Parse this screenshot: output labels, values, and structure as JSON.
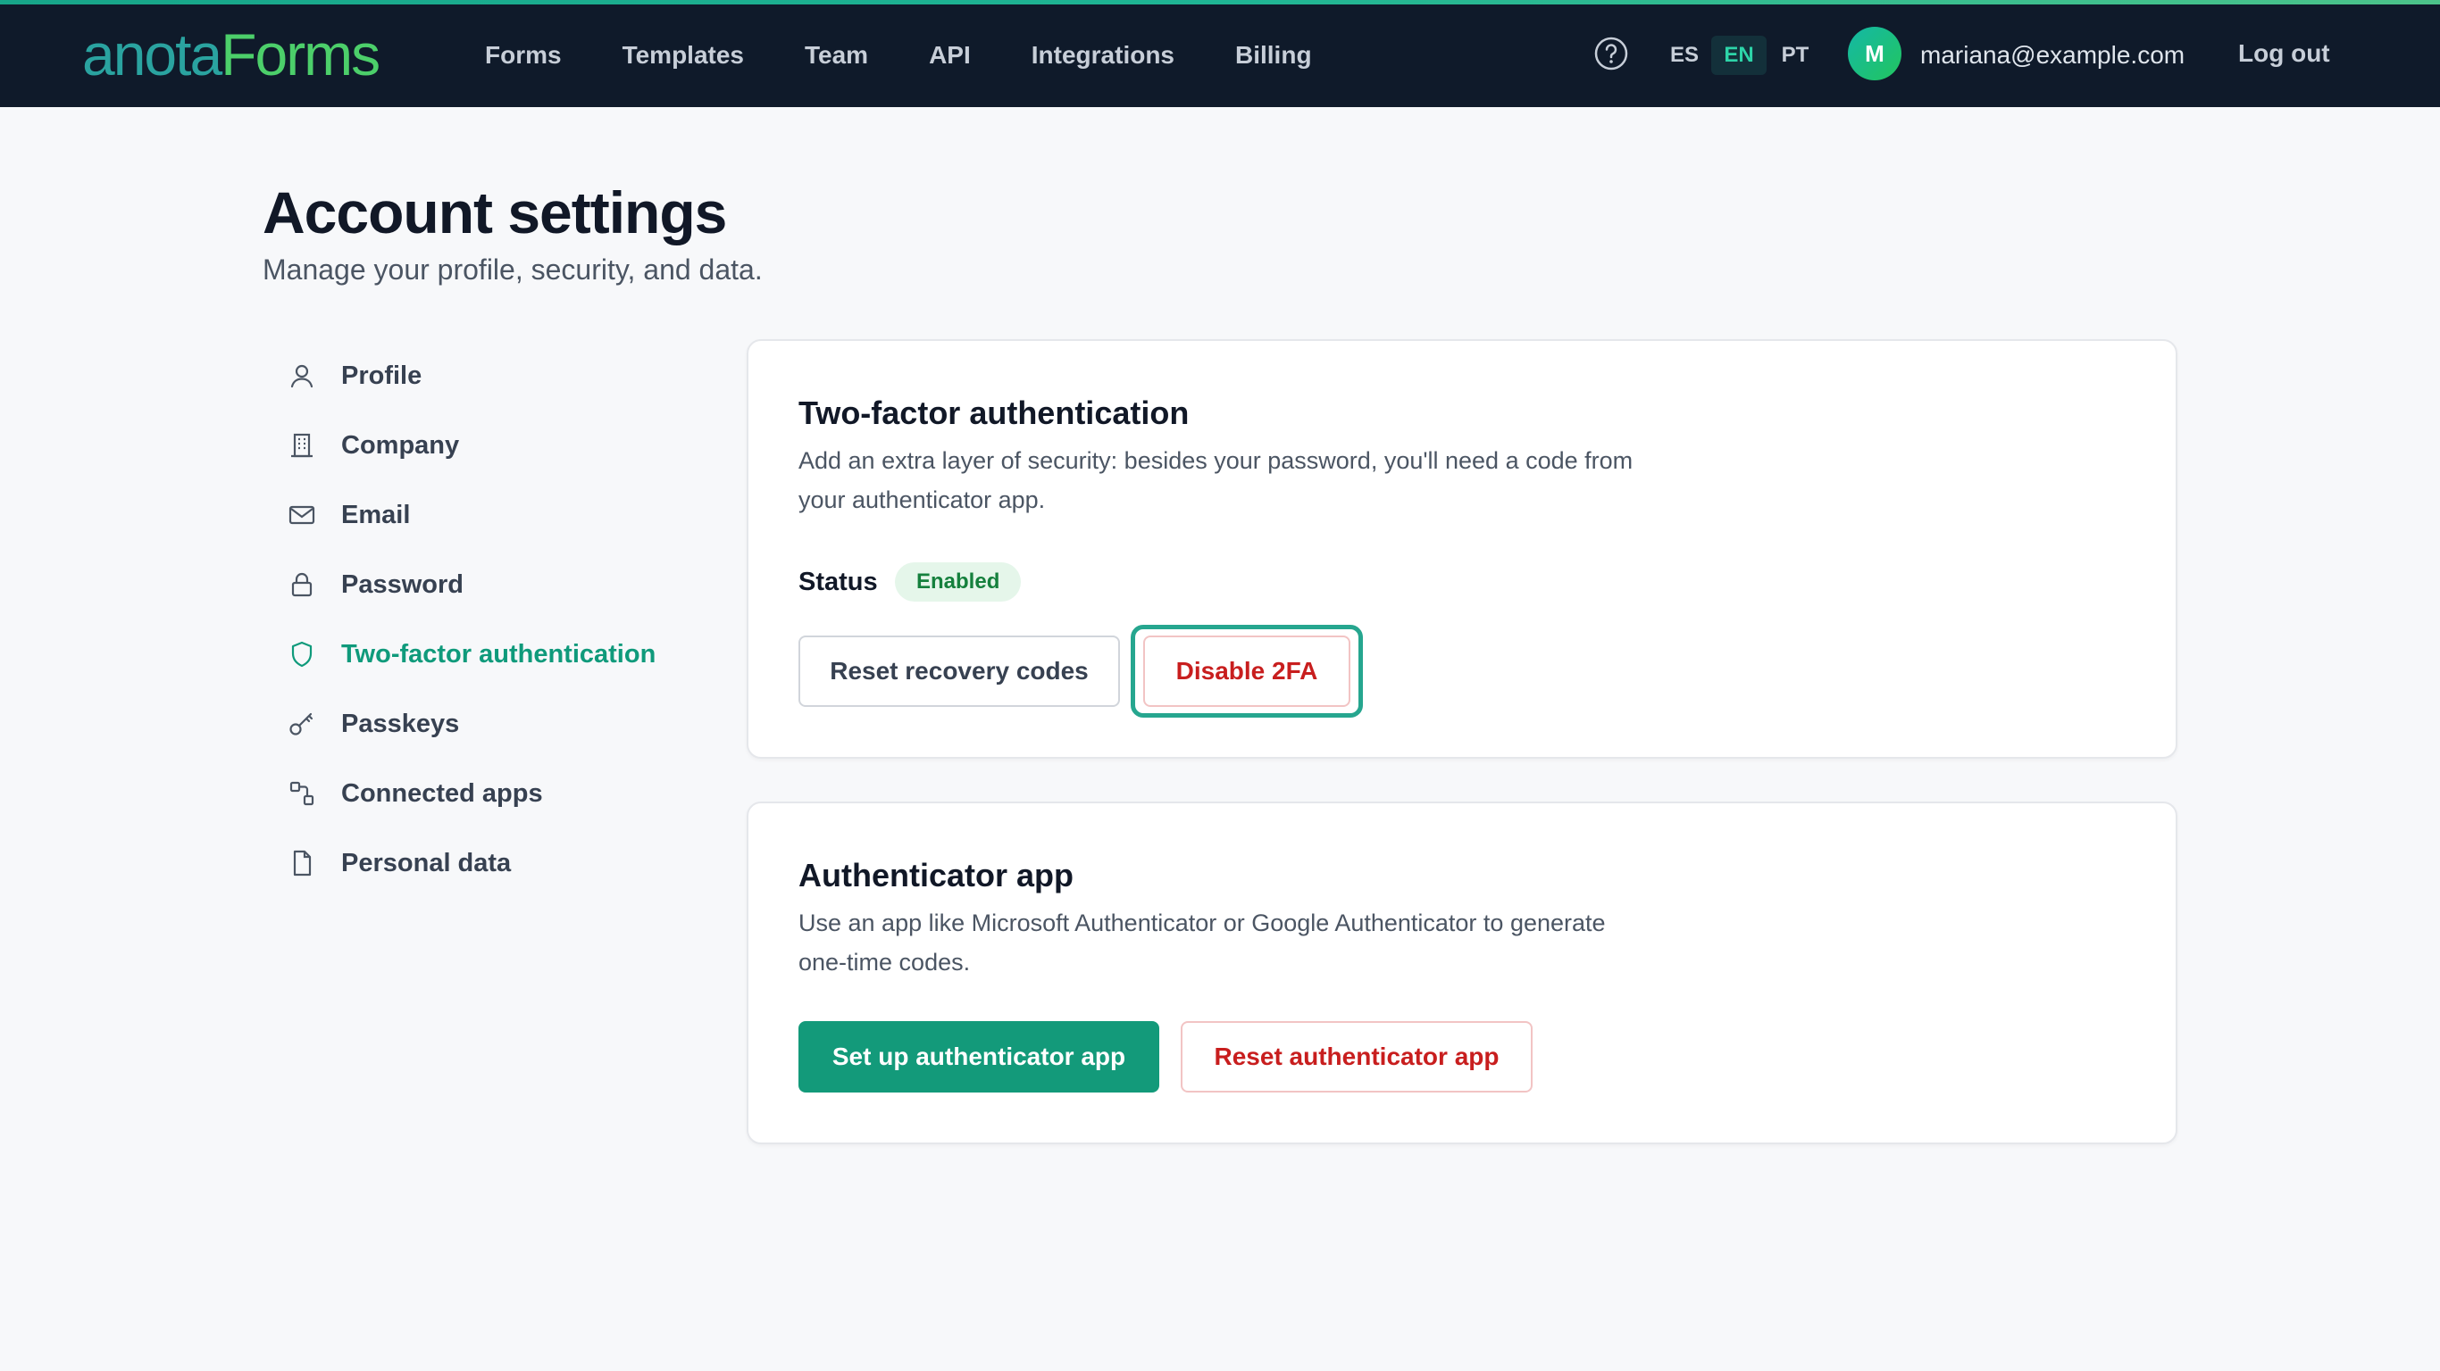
{
  "brand": {
    "part1": "anota",
    "part2": "Forms"
  },
  "nav": [
    "Forms",
    "Templates",
    "Team",
    "API",
    "Integrations",
    "Billing"
  ],
  "languages": {
    "es": "ES",
    "en": "EN",
    "pt": "PT"
  },
  "user": {
    "initial": "M",
    "email": "mariana@example.com"
  },
  "logout_label": "Log out",
  "page": {
    "title": "Account settings",
    "subtitle": "Manage your profile, security, and data."
  },
  "sidebar": {
    "items": [
      {
        "label": "Profile",
        "icon": "user-icon"
      },
      {
        "label": "Company",
        "icon": "building-icon"
      },
      {
        "label": "Email",
        "icon": "mail-icon"
      },
      {
        "label": "Password",
        "icon": "lock-icon"
      },
      {
        "label": "Two-factor authentication",
        "icon": "shield-icon",
        "active": true
      },
      {
        "label": "Passkeys",
        "icon": "key-icon"
      },
      {
        "label": "Connected apps",
        "icon": "apps-icon"
      },
      {
        "label": "Personal data",
        "icon": "document-icon"
      }
    ]
  },
  "twofa": {
    "title": "Two-factor authentication",
    "description": "Add an extra layer of security: besides your password, you'll need a code from your authenticator app.",
    "status_label": "Status",
    "status_value": "Enabled",
    "reset_codes_label": "Reset recovery codes",
    "disable_label": "Disable 2FA"
  },
  "authenticator": {
    "title": "Authenticator app",
    "description": "Use an app like Microsoft Authenticator or Google Authenticator to generate one-time codes.",
    "setup_label": "Set up authenticator app",
    "reset_label": "Reset authenticator app"
  },
  "colors": {
    "accent": "#139a7a",
    "danger": "#c81e1e",
    "topbar": "#0f1a2a"
  }
}
